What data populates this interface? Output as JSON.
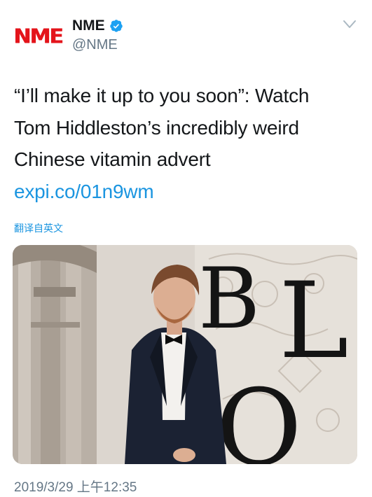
{
  "account": {
    "avatar_text": "NME",
    "display_name": "NME",
    "handle": "@NME",
    "verified": true
  },
  "tweet": {
    "text_main": "“I’ll make it up to you soon”: Watch Tom Hiddleston’s incredibly weird Chinese vitamin advert ",
    "link_text": "expi.co/01n9wm",
    "translate_label": "翻译自英文",
    "timestamp": "2019/3/29 上午12:35"
  },
  "media": {
    "backdrop_letters": "BL\nLO"
  },
  "colors": {
    "brand_red": "#e4141b",
    "link_blue": "#1b95e0",
    "muted_gray": "#657786",
    "text_dark": "#14171a"
  }
}
